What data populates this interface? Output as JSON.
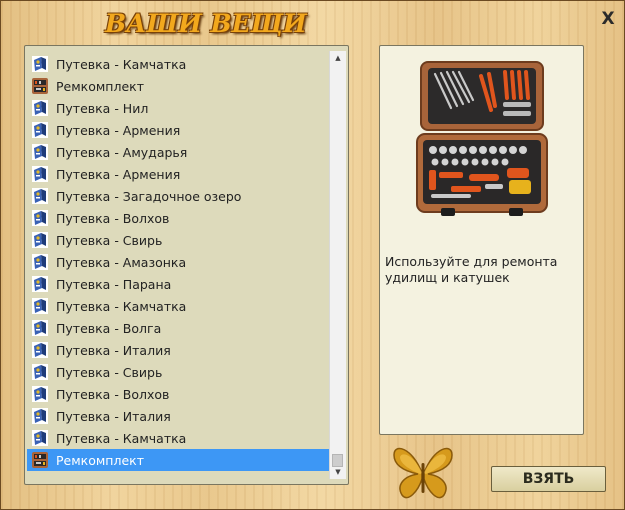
{
  "header": {
    "title": "ВАШИ ВЕЩИ",
    "close_label": "X"
  },
  "inventory": {
    "items": [
      {
        "label": "Путевка - Камчатка",
        "icon": "voucher-icon"
      },
      {
        "label": "Ремкомплект",
        "icon": "repair-kit-icon"
      },
      {
        "label": "Путевка - Нил",
        "icon": "voucher-icon"
      },
      {
        "label": "Путевка - Армения",
        "icon": "voucher-icon"
      },
      {
        "label": "Путевка - Амударья",
        "icon": "voucher-icon"
      },
      {
        "label": "Путевка - Армения",
        "icon": "voucher-icon"
      },
      {
        "label": "Путевка - Загадочное озеро",
        "icon": "voucher-icon"
      },
      {
        "label": "Путевка - Волхов",
        "icon": "voucher-icon"
      },
      {
        "label": "Путевка - Свирь",
        "icon": "voucher-icon"
      },
      {
        "label": "Путевка - Амазонка",
        "icon": "voucher-icon"
      },
      {
        "label": "Путевка - Парана",
        "icon": "voucher-icon"
      },
      {
        "label": "Путевка - Камчатка",
        "icon": "voucher-icon"
      },
      {
        "label": "Путевка - Волга",
        "icon": "voucher-icon"
      },
      {
        "label": "Путевка - Италия",
        "icon": "voucher-icon"
      },
      {
        "label": "Путевка - Свирь",
        "icon": "voucher-icon"
      },
      {
        "label": "Путевка - Волхов",
        "icon": "voucher-icon"
      },
      {
        "label": "Путевка - Италия",
        "icon": "voucher-icon"
      },
      {
        "label": "Путевка - Камчатка",
        "icon": "voucher-icon"
      },
      {
        "label": "Ремкомплект",
        "icon": "repair-kit-icon",
        "selected": true
      }
    ],
    "selected_color": "#3d97f5"
  },
  "detail": {
    "image_icon": "toolbox-icon",
    "description": "Используйте для ремонта удилищ и катушек"
  },
  "actions": {
    "take_label": "ВЗЯТЬ",
    "decoration_icon": "butterfly-icon"
  },
  "colors": {
    "title": "#f2a81d",
    "list_bg": "#dddabb",
    "panel_bg": "#f4f2e0"
  }
}
